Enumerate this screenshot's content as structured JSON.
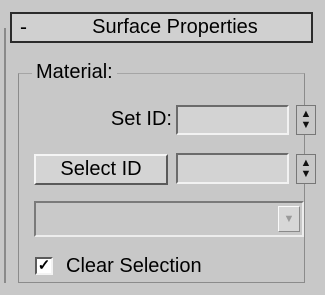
{
  "rollout": {
    "toggle_label": "-",
    "title": "Surface Properties"
  },
  "material_group": {
    "label": "Material:",
    "set_id": {
      "label": "Set ID:",
      "value": ""
    },
    "select_id": {
      "button_label": "Select ID",
      "value": ""
    },
    "dropdown": {
      "selected_value": ""
    },
    "clear_selection": {
      "label": "Clear Selection",
      "checked": true
    }
  },
  "icons": {
    "spinner_up": "▲",
    "spinner_down": "▼",
    "dropdown_arrow": "▼",
    "checkmark": "✓"
  }
}
